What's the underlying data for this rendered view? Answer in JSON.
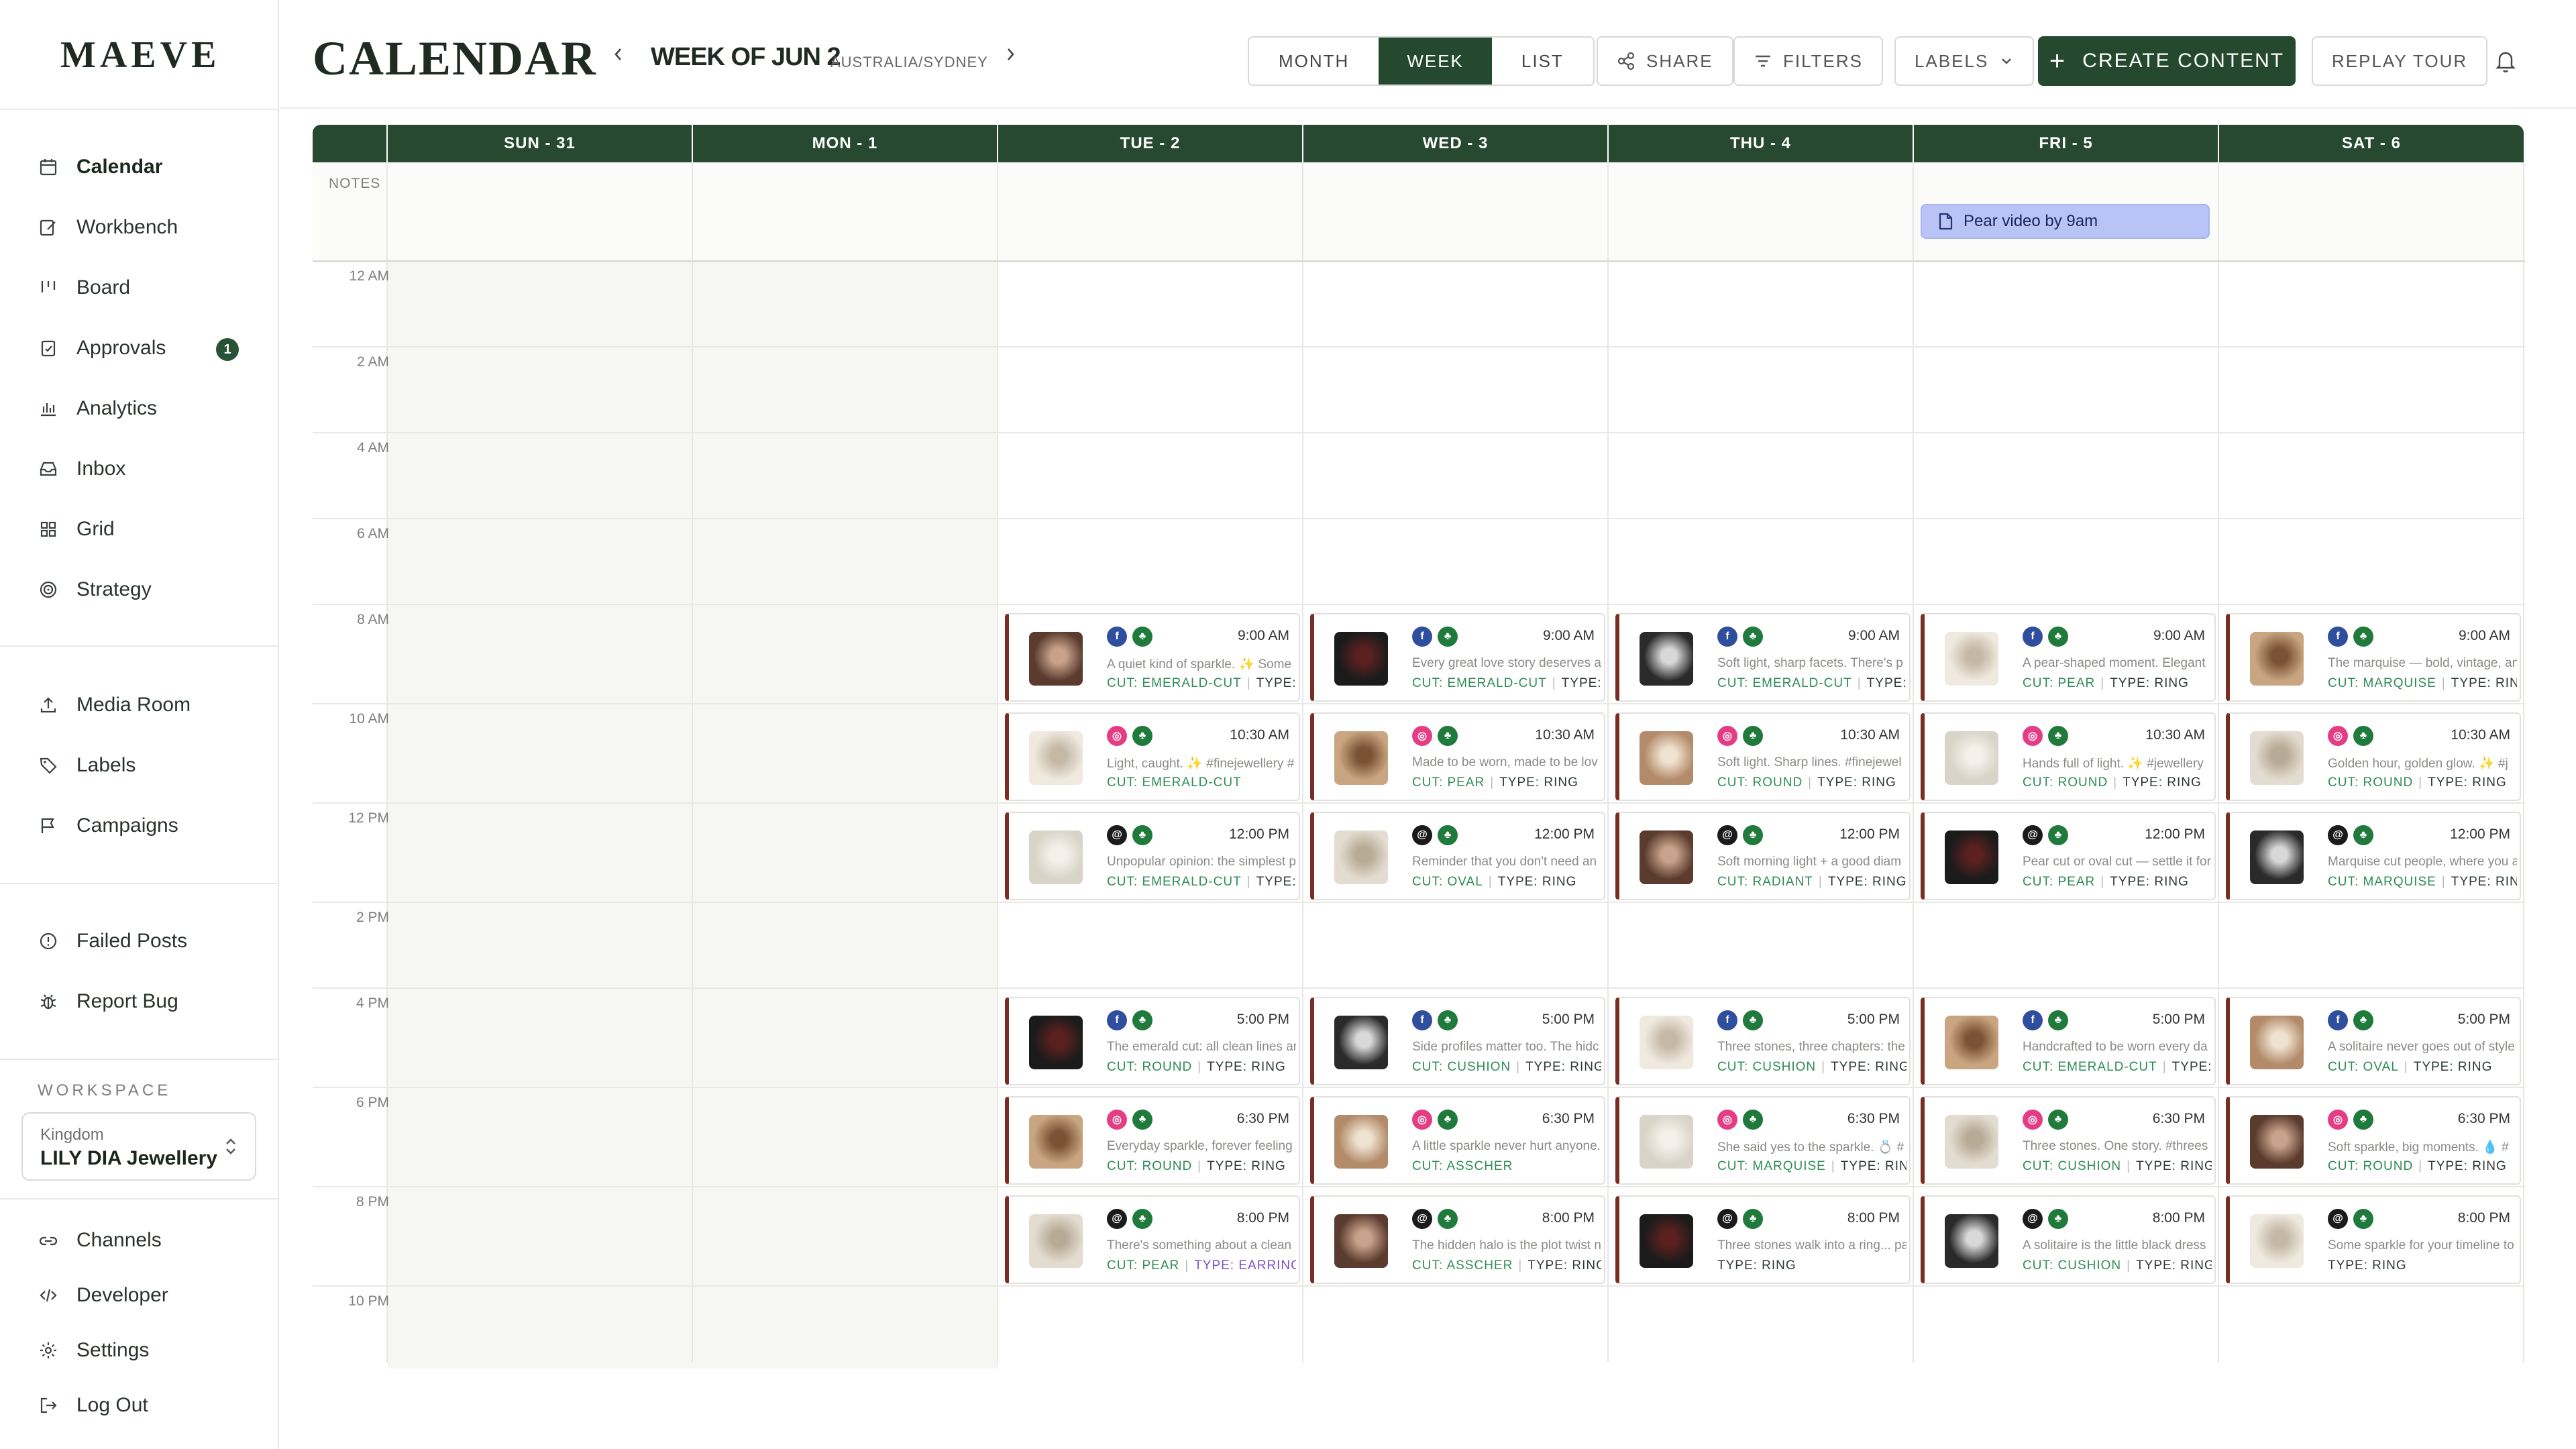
{
  "brand": "MAEVE",
  "sidebar": {
    "primary": [
      {
        "label": "Calendar",
        "icon": "calendar-icon",
        "active": true
      },
      {
        "label": "Workbench",
        "icon": "workbench-icon"
      },
      {
        "label": "Board",
        "icon": "board-icon"
      },
      {
        "label": "Approvals",
        "icon": "approvals-icon",
        "badge": "1"
      },
      {
        "label": "Analytics",
        "icon": "analytics-icon"
      },
      {
        "label": "Inbox",
        "icon": "inbox-icon"
      },
      {
        "label": "Grid",
        "icon": "grid-icon"
      },
      {
        "label": "Strategy",
        "icon": "strategy-icon"
      }
    ],
    "secondary": [
      {
        "label": "Media Room",
        "icon": "upload-icon"
      },
      {
        "label": "Labels",
        "icon": "tag-icon"
      },
      {
        "label": "Campaigns",
        "icon": "flag-icon"
      }
    ],
    "support": [
      {
        "label": "Failed Posts",
        "icon": "alert-icon"
      },
      {
        "label": "Report Bug",
        "icon": "bug-icon"
      }
    ],
    "workspace": {
      "section_label": "WORKSPACE",
      "sub": "Kingdom",
      "name": "LILY DIA Jewellery"
    },
    "bottom": [
      {
        "label": "Channels",
        "icon": "link-icon"
      },
      {
        "label": "Developer",
        "icon": "code-icon"
      },
      {
        "label": "Settings",
        "icon": "gear-icon"
      },
      {
        "label": "Log Out",
        "icon": "logout-icon"
      }
    ]
  },
  "header": {
    "title": "CALENDAR",
    "week_label": "WEEK OF JUN 2",
    "timezone": "AUSTRALIA/SYDNEY",
    "views": [
      "MONTH",
      "WEEK",
      "LIST"
    ],
    "active_view": "WEEK",
    "share": "SHARE",
    "filters": "FILTERS",
    "labels": "LABELS",
    "create": "CREATE CONTENT",
    "replay": "REPLAY TOUR"
  },
  "calendar": {
    "days": [
      "SUN - 31",
      "MON - 1",
      "TUE - 2",
      "WED - 3",
      "THU - 4",
      "FRI - 5",
      "SAT - 6"
    ],
    "notes_label": "NOTES",
    "note": {
      "day": 5,
      "text": "Pear video by 9am"
    },
    "time_labels": [
      "12 AM",
      "2 AM",
      "4 AM",
      "6 AM",
      "8 AM",
      "10 AM",
      "12 PM",
      "2 PM",
      "4 PM",
      "6 PM",
      "8 PM",
      "10 PM"
    ],
    "colors": {
      "header": "#26492f",
      "card_accent": "#7a2e22",
      "note_bg": "#b9c3f6"
    },
    "slots": [
      {
        "time": "9:00 AM",
        "icons": [
          "fb",
          "tree"
        ]
      },
      {
        "time": "10:30 AM",
        "icons": [
          "ig",
          "tree"
        ]
      },
      {
        "time": "12:00 PM",
        "icons": [
          "th",
          "tree"
        ]
      },
      {
        "time": "5:00 PM",
        "icons": [
          "fb",
          "tree"
        ]
      },
      {
        "time": "6:30 PM",
        "icons": [
          "ig",
          "tree"
        ]
      },
      {
        "time": "8:00 PM",
        "icons": [
          "th",
          "tree"
        ]
      }
    ],
    "events": [
      {
        "day": 2,
        "slot": 0,
        "caption": "A quiet kind of sparkle. ✨ Some",
        "cut": "CUT: EMERALD-CUT",
        "type": "TYPE: RI"
      },
      {
        "day": 2,
        "slot": 1,
        "caption": "Light, caught. ✨ #finejewellery #",
        "cut": "CUT: EMERALD-CUT",
        "type": ""
      },
      {
        "day": 2,
        "slot": 2,
        "caption": "Unpopular opinion: the simplest p",
        "cut": "CUT: EMERALD-CUT",
        "type": "TYPE: N"
      },
      {
        "day": 2,
        "slot": 3,
        "caption": "The emerald cut: all clean lines an",
        "cut": "CUT: ROUND",
        "type": "TYPE: RING"
      },
      {
        "day": 2,
        "slot": 4,
        "caption": "Everyday sparkle, forever feeling",
        "cut": "CUT: ROUND",
        "type": "TYPE: RING"
      },
      {
        "day": 2,
        "slot": 5,
        "caption": "There's something about a clean",
        "cut": "CUT: PEAR",
        "type": "TYPE: EARRINGS"
      },
      {
        "day": 3,
        "slot": 0,
        "caption": "Every great love story deserves a",
        "cut": "CUT: EMERALD-CUT",
        "type": "TYPE: R"
      },
      {
        "day": 3,
        "slot": 1,
        "caption": "Made to be worn, made to be lov",
        "cut": "CUT: PEAR",
        "type": "TYPE: RING"
      },
      {
        "day": 3,
        "slot": 2,
        "caption": "Reminder that you don't need an",
        "cut": "CUT: OVAL",
        "type": "TYPE: RING"
      },
      {
        "day": 3,
        "slot": 3,
        "caption": "Side profiles matter too. The hidc",
        "cut": "CUT: CUSHION",
        "type": "TYPE: RING"
      },
      {
        "day": 3,
        "slot": 4,
        "caption": "A little sparkle never hurt anyone.",
        "cut": "CUT: ASSCHER",
        "type": ""
      },
      {
        "day": 3,
        "slot": 5,
        "caption": "The hidden halo is the plot twist n",
        "cut": "CUT: ASSCHER",
        "type": "TYPE: RING"
      },
      {
        "day": 4,
        "slot": 0,
        "caption": "Soft light, sharp facets. There's p",
        "cut": "CUT: EMERALD-CUT",
        "type": "TYPE: R"
      },
      {
        "day": 4,
        "slot": 1,
        "caption": "Soft light. Sharp lines. #finejewel",
        "cut": "CUT: ROUND",
        "type": "TYPE: RING"
      },
      {
        "day": 4,
        "slot": 2,
        "caption": "Soft morning light + a good diam",
        "cut": "CUT: RADIANT",
        "type": "TYPE: RING"
      },
      {
        "day": 4,
        "slot": 3,
        "caption": "Three stones, three chapters: the",
        "cut": "CUT: CUSHION",
        "type": "TYPE: RING"
      },
      {
        "day": 4,
        "slot": 4,
        "caption": "She said yes to the sparkle. 💍 #",
        "cut": "CUT: MARQUISE",
        "type": "TYPE: RING"
      },
      {
        "day": 4,
        "slot": 5,
        "caption": "Three stones walk into a ring... pa",
        "cut": "",
        "type": "TYPE: RING"
      },
      {
        "day": 5,
        "slot": 0,
        "caption": "A pear-shaped moment. Elegant",
        "cut": "CUT: PEAR",
        "type": "TYPE: RING"
      },
      {
        "day": 5,
        "slot": 1,
        "caption": "Hands full of light. ✨ #jewellery",
        "cut": "CUT: ROUND",
        "type": "TYPE: RING"
      },
      {
        "day": 5,
        "slot": 2,
        "caption": "Pear cut or oval cut — settle it for",
        "cut": "CUT: PEAR",
        "type": "TYPE: RING"
      },
      {
        "day": 5,
        "slot": 3,
        "caption": "Handcrafted to be worn every da",
        "cut": "CUT: EMERALD-CUT",
        "type": "TYPE: R"
      },
      {
        "day": 5,
        "slot": 4,
        "caption": "Three stones. One story. #threes",
        "cut": "CUT: CUSHION",
        "type": "TYPE: RING"
      },
      {
        "day": 5,
        "slot": 5,
        "caption": "A solitaire is the little black dress",
        "cut": "CUT: CUSHION",
        "type": "TYPE: RING"
      },
      {
        "day": 6,
        "slot": 0,
        "caption": "The marquise — bold, vintage, an",
        "cut": "CUT: MARQUISE",
        "type": "TYPE: RING"
      },
      {
        "day": 6,
        "slot": 1,
        "caption": "Golden hour, golden glow. ✨ #j",
        "cut": "CUT: ROUND",
        "type": "TYPE: RING"
      },
      {
        "day": 6,
        "slot": 2,
        "caption": "Marquise cut people, where you a",
        "cut": "CUT: MARQUISE",
        "type": "TYPE: RING"
      },
      {
        "day": 6,
        "slot": 3,
        "caption": "A solitaire never goes out of style",
        "cut": "CUT: OVAL",
        "type": "TYPE: RING"
      },
      {
        "day": 6,
        "slot": 4,
        "caption": "Soft sparkle, big moments. 💧 #",
        "cut": "CUT: ROUND",
        "type": "TYPE: RING"
      },
      {
        "day": 6,
        "slot": 5,
        "caption": "Some sparkle for your timeline to",
        "cut": "",
        "type": "TYPE: RING"
      }
    ]
  }
}
